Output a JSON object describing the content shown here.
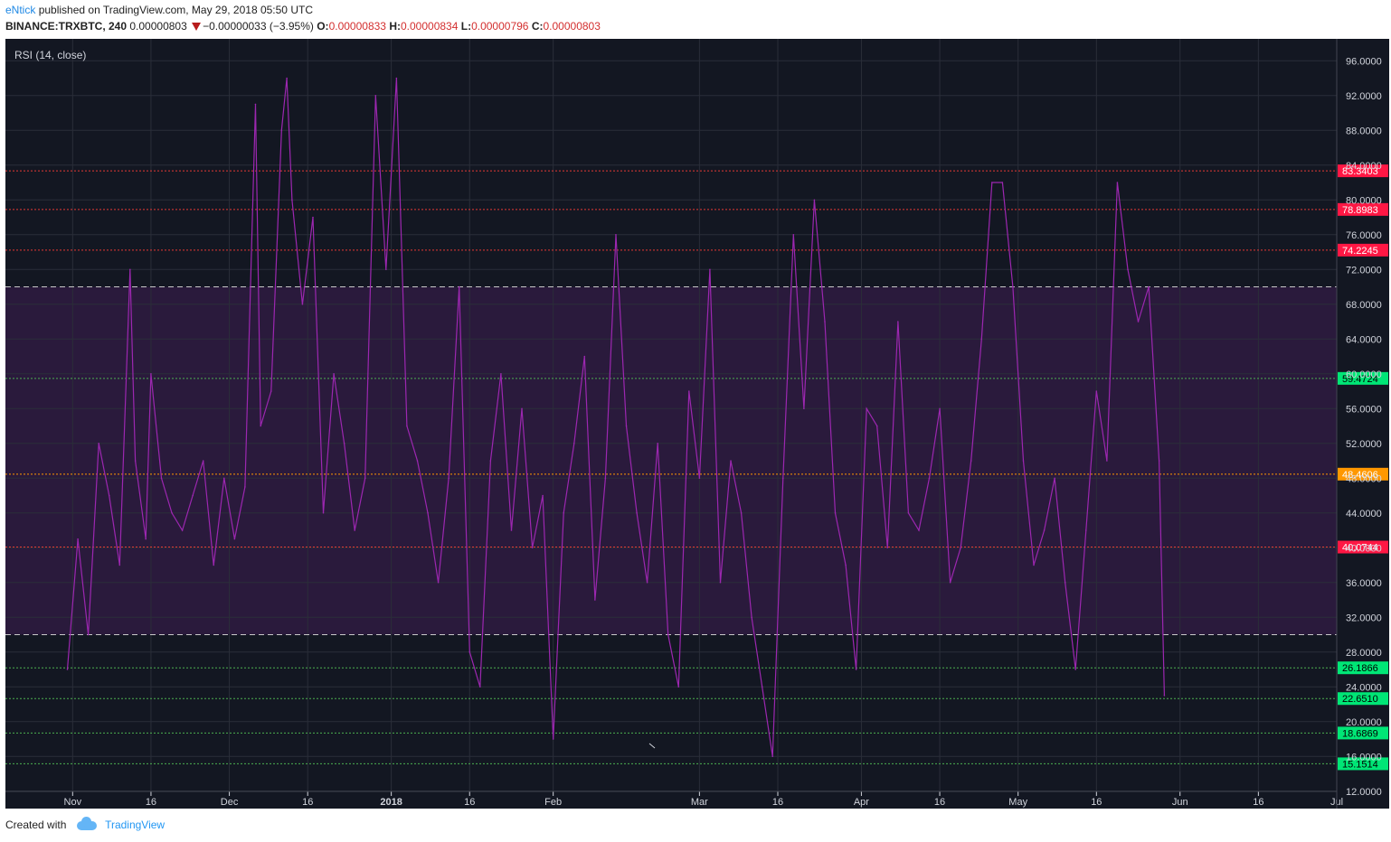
{
  "header": {
    "author": "eNtick",
    "published_text": "published on TradingView.com, May 29, 2018 05:50 UTC",
    "symbol": "BINANCE:TRXBTC, 240",
    "price": "0.00000803",
    "change": "−0.00000033 (−3.95%)",
    "o_label": "O:",
    "o_value": "0.00000833",
    "h_label": "H:",
    "h_value": "0.00000834",
    "l_label": "L:",
    "l_value": "0.00000796",
    "c_label": "C:",
    "c_value": "0.00000803",
    "direction_icon": "down-triangle-icon"
  },
  "indicator_label": "RSI (14, close)",
  "footer": {
    "created_with": "Created with",
    "brand": "TradingView",
    "brand_icon": "tradingview-cloud-icon"
  },
  "colors": {
    "background": "#131722",
    "band_fill": "#2a1a3c",
    "rsi_line": "#9c27b0",
    "red_line": "#e53935",
    "green_line": "#4caf50",
    "orange_line": "#ff9800",
    "green_badge": "#00e676",
    "red_badge": "#ff1744",
    "orange_badge": "#ff9800",
    "grid": "#2a2e39",
    "axis_text": "#d1d4dc"
  },
  "chart_data": {
    "type": "line",
    "title": "RSI (14, close)",
    "xlabel": "",
    "ylabel": "",
    "ylim": [
      10,
      98
    ],
    "x_ticks": [
      "Nov",
      "16",
      "Dec",
      "16",
      "2018",
      "16",
      "Feb",
      "Mar",
      "16",
      "Apr",
      "16",
      "May",
      "16",
      "Jun",
      "16",
      "Jul"
    ],
    "y_ticks": [
      "96.0000",
      "92.0000",
      "88.0000",
      "84.0000",
      "80.0000",
      "76.0000",
      "72.0000",
      "68.0000",
      "64.0000",
      "60.0000",
      "56.0000",
      "52.0000",
      "48.0000",
      "44.0000",
      "40.0000",
      "36.0000",
      "32.0000",
      "28.0000",
      "24.0000",
      "20.0000",
      "16.0000",
      "12.0000"
    ],
    "band": {
      "upper": 70,
      "lower": 30
    },
    "horizontal_levels": [
      {
        "value": 83.3403,
        "label": "83.3403",
        "kind": "red"
      },
      {
        "value": 78.8983,
        "label": "78.8983",
        "kind": "red"
      },
      {
        "value": 74.2245,
        "label": "74.2245",
        "kind": "red"
      },
      {
        "value": 59.4724,
        "label": "59.4724",
        "kind": "green"
      },
      {
        "value": 48.4606,
        "label": "48.4606",
        "kind": "orange"
      },
      {
        "value": 40.0744,
        "label": "40.0744",
        "kind": "red"
      },
      {
        "value": 26.1866,
        "label": "26.1866",
        "kind": "green"
      },
      {
        "value": 22.651,
        "label": "22.6510",
        "kind": "green"
      },
      {
        "value": 18.6869,
        "label": "18.6869",
        "kind": "green"
      },
      {
        "value": 15.1514,
        "label": "15.1514",
        "kind": "green"
      }
    ],
    "series": [
      {
        "x": [
          "2017-10-31",
          "2017-11-02",
          "2017-11-04",
          "2017-11-06",
          "2017-11-08",
          "2017-11-10",
          "2017-11-12",
          "2017-11-13",
          "2017-11-15",
          "2017-11-16",
          "2017-11-18",
          "2017-11-20",
          "2017-11-22",
          "2017-11-24",
          "2017-11-26",
          "2017-11-28",
          "2017-11-30",
          "2017-12-02",
          "2017-12-04",
          "2017-12-06",
          "2017-12-07",
          "2017-12-09",
          "2017-12-11",
          "2017-12-12",
          "2017-12-13",
          "2017-12-15",
          "2017-12-17",
          "2017-12-19",
          "2017-12-21",
          "2017-12-23",
          "2017-12-25",
          "2017-12-27",
          "2017-12-29",
          "2017-12-31",
          "2018-01-02",
          "2018-01-04",
          "2018-01-06",
          "2018-01-08",
          "2018-01-10",
          "2018-01-12",
          "2018-01-14",
          "2018-01-16",
          "2018-01-18",
          "2018-01-20",
          "2018-01-22",
          "2018-01-24",
          "2018-01-26",
          "2018-01-28",
          "2018-01-30",
          "2018-02-01",
          "2018-02-03",
          "2018-02-05",
          "2018-02-07",
          "2018-02-09",
          "2018-02-11",
          "2018-02-13",
          "2018-02-15",
          "2018-02-17",
          "2018-02-19",
          "2018-02-21",
          "2018-02-23",
          "2018-02-25",
          "2018-02-27",
          "2018-03-01",
          "2018-03-03",
          "2018-03-05",
          "2018-03-07",
          "2018-03-09",
          "2018-03-11",
          "2018-03-13",
          "2018-03-15",
          "2018-03-17",
          "2018-03-19",
          "2018-03-21",
          "2018-03-23",
          "2018-03-25",
          "2018-03-27",
          "2018-03-29",
          "2018-03-31",
          "2018-04-02",
          "2018-04-04",
          "2018-04-06",
          "2018-04-08",
          "2018-04-10",
          "2018-04-12",
          "2018-04-14",
          "2018-04-16",
          "2018-04-18",
          "2018-04-20",
          "2018-04-22",
          "2018-04-24",
          "2018-04-26",
          "2018-04-28",
          "2018-04-30",
          "2018-05-02",
          "2018-05-04",
          "2018-05-06",
          "2018-05-08",
          "2018-05-10",
          "2018-05-12",
          "2018-05-14",
          "2018-05-16",
          "2018-05-18",
          "2018-05-20",
          "2018-05-22",
          "2018-05-24",
          "2018-05-26",
          "2018-05-28",
          "2018-05-29"
        ],
        "values": [
          26,
          41,
          30,
          52,
          46,
          38,
          72,
          50,
          41,
          60,
          48,
          44,
          42,
          46,
          50,
          38,
          48,
          41,
          47,
          91,
          54,
          58,
          88,
          94,
          80,
          68,
          78,
          44,
          60,
          52,
          42,
          48,
          92,
          72,
          94,
          54,
          50,
          44,
          36,
          48,
          70,
          28,
          24,
          50,
          60,
          42,
          56,
          40,
          46,
          18,
          44,
          52,
          62,
          34,
          48,
          76,
          54,
          44,
          36,
          52,
          30,
          24,
          58,
          48,
          72,
          36,
          50,
          44,
          32,
          24,
          16,
          48,
          76,
          56,
          80,
          66,
          44,
          38,
          26,
          56,
          54,
          40,
          66,
          44,
          42,
          48,
          56,
          36,
          40,
          50,
          64,
          82,
          82,
          70,
          50,
          38,
          42,
          48,
          36,
          26,
          42,
          58,
          50,
          82,
          72,
          66,
          70,
          50,
          23
        ]
      }
    ]
  }
}
